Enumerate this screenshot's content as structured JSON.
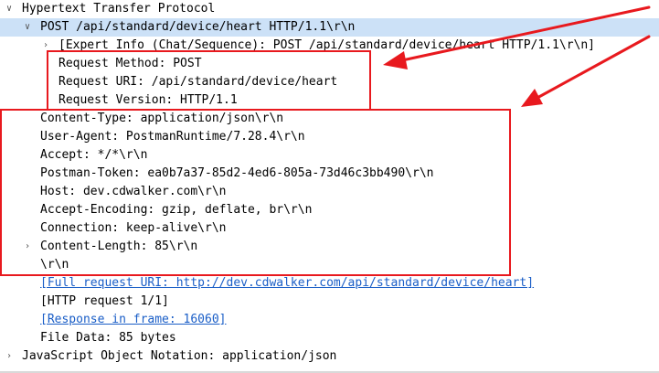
{
  "tree": {
    "http_protocol": "Hypertext Transfer Protocol",
    "request_line": "POST /api/standard/device/heart HTTP/1.1\\r\\n",
    "expert_info": "[Expert Info (Chat/Sequence): POST /api/standard/device/heart HTTP/1.1\\r\\n]",
    "request_method": "Request Method: POST",
    "request_uri": "Request URI: /api/standard/device/heart",
    "request_version": "Request Version: HTTP/1.1",
    "content_type": "Content-Type: application/json\\r\\n",
    "user_agent": "User-Agent: PostmanRuntime/7.28.4\\r\\n",
    "accept": "Accept: */*\\r\\n",
    "postman_token": "Postman-Token: ea0b7a37-85d2-4ed6-805a-73d46c3bb490\\r\\n",
    "host": "Host: dev.cdwalker.com\\r\\n",
    "accept_encoding": "Accept-Encoding: gzip, deflate, br\\r\\n",
    "connection": "Connection: keep-alive\\r\\n",
    "content_length": "Content-Length: 85\\r\\n",
    "crlf": "\\r\\n",
    "full_request_uri": "[Full request URI: http://dev.cdwalker.com/api/standard/device/heart]",
    "http_request_count": "[HTTP request 1/1]",
    "response_in_frame": "[Response in frame: 16060]",
    "file_data": "File Data: 85 bytes",
    "json_protocol": "JavaScript Object Notation: application/json"
  },
  "colors": {
    "selection": "#cce1f7",
    "annotation": "#e8191e",
    "link": "#1a5ec7"
  },
  "icons": {
    "expanded": "chevron-down-icon",
    "collapsed": "chevron-right-icon"
  }
}
